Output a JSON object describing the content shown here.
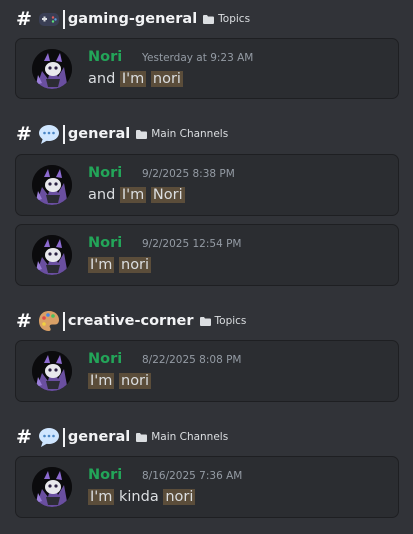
{
  "results": [
    {
      "channel": {
        "hash": "#",
        "emoji": "gamepad-icon",
        "name": "gaming-general",
        "category": "Topics"
      },
      "message": {
        "author": "Nori",
        "timestamp": "Yesterday at 9:23 AM",
        "content": [
          {
            "text": "and "
          },
          {
            "text": "I'm",
            "hl": true
          },
          {
            "text": " "
          },
          {
            "text": "nori",
            "hl": true
          }
        ]
      }
    },
    {
      "channel": {
        "hash": "#",
        "emoji": "speech-bubble-icon",
        "name": "general",
        "category": "Main Channels"
      },
      "messages": [
        {
          "author": "Nori",
          "timestamp": "9/2/2025 8:38 PM",
          "content": [
            {
              "text": "and "
            },
            {
              "text": "I'm",
              "hl": true
            },
            {
              "text": " "
            },
            {
              "text": "Nori",
              "hl": true
            }
          ]
        },
        {
          "author": "Nori",
          "timestamp": "9/2/2025 12:54 PM",
          "content": [
            {
              "text": "I'm",
              "hl": true
            },
            {
              "text": " "
            },
            {
              "text": "nori",
              "hl": true
            }
          ]
        }
      ]
    },
    {
      "channel": {
        "hash": "#",
        "emoji": "palette-icon",
        "name": "creative-corner",
        "category": "Topics"
      },
      "message": {
        "author": "Nori",
        "timestamp": "8/22/2025 8:08 PM",
        "content": [
          {
            "text": "I'm",
            "hl": true
          },
          {
            "text": " "
          },
          {
            "text": "nori",
            "hl": true
          }
        ]
      }
    },
    {
      "channel": {
        "hash": "#",
        "emoji": "speech-bubble-icon",
        "name": "general",
        "category": "Main Channels"
      },
      "message": {
        "author": "Nori",
        "timestamp": "8/16/2025 7:36 AM",
        "content": [
          {
            "text": "I'm",
            "hl": true
          },
          {
            "text": " kinda "
          },
          {
            "text": "nori",
            "hl": true
          }
        ]
      }
    }
  ],
  "colors": {
    "background": "#313338",
    "card": "#2b2d31",
    "author": "#23a559",
    "highlight": "#5b4d3a",
    "muted": "#949ba4"
  }
}
